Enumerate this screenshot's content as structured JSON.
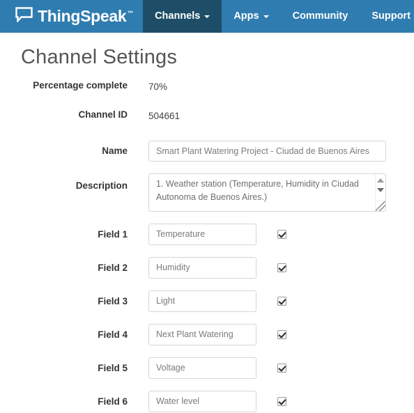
{
  "navbar": {
    "brand": {
      "name": "ThingSpeak",
      "tm": "™",
      "icon": "speech-bubble-icon"
    },
    "items": [
      {
        "label": "Channels",
        "has_caret": true,
        "active": true
      },
      {
        "label": "Apps",
        "has_caret": true,
        "active": false
      },
      {
        "label": "Community",
        "has_caret": false,
        "active": false
      },
      {
        "label": "Support",
        "has_caret": true,
        "active": false
      }
    ],
    "colors": {
      "background": "#2f7cb0",
      "active_background": "#1e4e67",
      "text": "#ffffff"
    }
  },
  "page": {
    "title": "Channel Settings"
  },
  "form": {
    "percentage_complete": {
      "label": "Percentage complete",
      "value": "70%"
    },
    "channel_id": {
      "label": "Channel ID",
      "value": "504661"
    },
    "name": {
      "label": "Name",
      "value": "Smart Plant Watering Project - Ciudad de Buenos Aires"
    },
    "description": {
      "label": "Description",
      "value": "1. Weather station (Temperature, Humidity in Ciudad Autonoma de Buenos Aires.)"
    },
    "fields": [
      {
        "label": "Field 1",
        "value": "Temperature",
        "checked": true
      },
      {
        "label": "Field 2",
        "value": "Humidity",
        "checked": true
      },
      {
        "label": "Field 3",
        "value": "Light",
        "checked": true
      },
      {
        "label": "Field 4",
        "value": "Next Plant Watering",
        "checked": true
      },
      {
        "label": "Field 5",
        "value": "Voltage",
        "checked": true
      },
      {
        "label": "Field 6",
        "value": "Water level",
        "checked": true
      }
    ]
  }
}
